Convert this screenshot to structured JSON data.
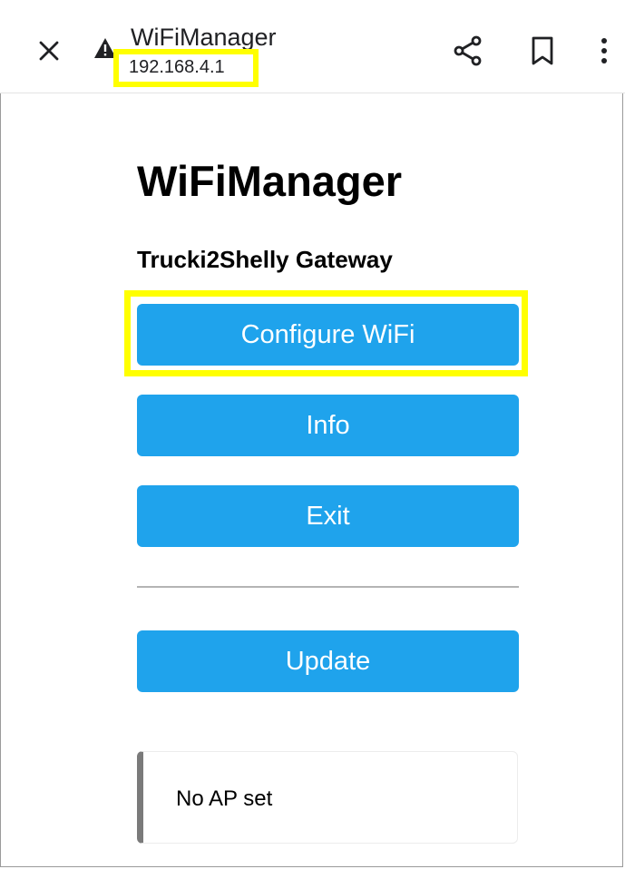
{
  "browser": {
    "page_title": "WiFiManager",
    "url": "192.168.4.1",
    "icons": {
      "close": "close-icon",
      "security": "warning-icon",
      "share": "share-icon",
      "bookmark": "bookmark-icon",
      "more": "more-vertical-icon"
    }
  },
  "page": {
    "heading": "WiFiManager",
    "device_name": "Trucki2Shelly Gateway",
    "buttons": {
      "configure": "Configure WiFi",
      "info": "Info",
      "exit": "Exit",
      "update": "Update"
    },
    "status_message": "No AP set"
  },
  "colors": {
    "button_bg": "#1fa3ec",
    "button_text": "#ffffff",
    "highlight": "#ffff00",
    "message_border": "#7a7a7a"
  }
}
